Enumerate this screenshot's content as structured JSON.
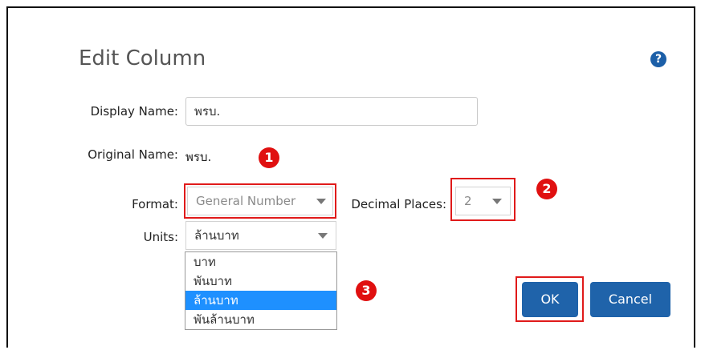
{
  "dialog": {
    "title": "Edit Column",
    "help_icon": "?",
    "display_name": {
      "label": "Display Name:",
      "value": "พรบ."
    },
    "original_name": {
      "label": "Original Name:",
      "value": "พรบ."
    },
    "format": {
      "label": "Format:",
      "value": "General Number"
    },
    "decimal_places": {
      "label": "Decimal Places:",
      "value": "2"
    },
    "units": {
      "label": "Units:",
      "value": "ล้านบาท",
      "options": [
        "บาท",
        "พันบาท",
        "ล้านบาท",
        "พันล้านบาท"
      ]
    },
    "ok_label": "OK",
    "cancel_label": "Cancel"
  },
  "annotations": {
    "badge1": "1",
    "badge2": "2",
    "badge3": "3"
  },
  "colors": {
    "primary_button": "#1f63aa",
    "highlight": "#e01a1a",
    "selected_option": "#1e90ff"
  }
}
